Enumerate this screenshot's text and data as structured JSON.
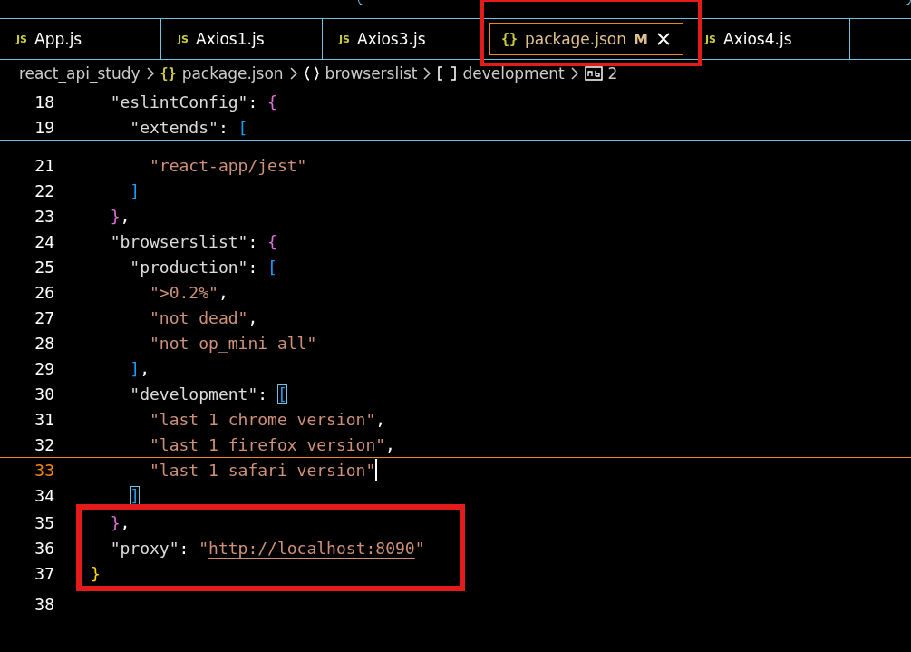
{
  "tabs": [
    {
      "kind": "js",
      "icon_text": "JS",
      "label": "App.js",
      "selected": false,
      "annotated": false
    },
    {
      "kind": "js",
      "icon_text": "JS",
      "label": "Axios1.js",
      "selected": false,
      "annotated": false
    },
    {
      "kind": "js",
      "icon_text": "JS",
      "label": "Axios3.js",
      "selected": false,
      "annotated": false
    },
    {
      "kind": "json",
      "icon_text": "{}",
      "label": "package.json",
      "selected": true,
      "status": "M",
      "annotated": true
    },
    {
      "kind": "js",
      "icon_text": "JS",
      "label": "Axios4.js",
      "selected": false,
      "annotated": false
    }
  ],
  "breadcrumbs": [
    {
      "kind": "folder",
      "label": "react_api_study"
    },
    {
      "kind": "json",
      "icon_text": "{}",
      "label": "package.json"
    },
    {
      "kind": "object",
      "label": "browserslist"
    },
    {
      "kind": "array",
      "label": "development"
    },
    {
      "kind": "string",
      "label": "2"
    }
  ],
  "sticky_lines": [
    {
      "number": "18",
      "tokens": [
        {
          "kind": "key",
          "text": "  \"eslintConfig\""
        },
        {
          "kind": "punct",
          "text": ": "
        },
        {
          "kind": "brace",
          "text": "{"
        }
      ]
    },
    {
      "number": "19",
      "tokens": [
        {
          "kind": "key",
          "text": "    \"extends\""
        },
        {
          "kind": "punct",
          "text": ": "
        },
        {
          "kind": "bracket",
          "text": "["
        }
      ]
    }
  ],
  "line_groups": [
    {
      "boxed": false,
      "lines": [
        {
          "number": "21",
          "current": false,
          "tokens": [
            {
              "kind": "string",
              "text": "      \"react-app/jest\""
            }
          ]
        },
        {
          "number": "22",
          "current": false,
          "tokens": [
            {
              "kind": "bracket",
              "text": "    ]"
            }
          ]
        },
        {
          "number": "23",
          "current": false,
          "tokens": [
            {
              "kind": "brace",
              "text": "  }"
            },
            {
              "kind": "punct",
              "text": ","
            }
          ]
        },
        {
          "number": "24",
          "current": false,
          "tokens": [
            {
              "kind": "key",
              "text": "  \"browserslist\""
            },
            {
              "kind": "punct",
              "text": ": "
            },
            {
              "kind": "brace",
              "text": "{"
            }
          ]
        },
        {
          "number": "25",
          "current": false,
          "tokens": [
            {
              "kind": "key",
              "text": "    \"production\""
            },
            {
              "kind": "punct",
              "text": ": "
            },
            {
              "kind": "bracket",
              "text": "["
            }
          ]
        },
        {
          "number": "26",
          "current": false,
          "tokens": [
            {
              "kind": "string",
              "text": "      \">0.2%\""
            },
            {
              "kind": "punct",
              "text": ","
            }
          ]
        },
        {
          "number": "27",
          "current": false,
          "tokens": [
            {
              "kind": "string",
              "text": "      \"not dead\""
            },
            {
              "kind": "punct",
              "text": ","
            }
          ]
        },
        {
          "number": "28",
          "current": false,
          "tokens": [
            {
              "kind": "string",
              "text": "      \"not op_mini all\""
            }
          ]
        },
        {
          "number": "29",
          "current": false,
          "tokens": [
            {
              "kind": "bracket",
              "text": "    ]"
            },
            {
              "kind": "punct",
              "text": ","
            }
          ]
        },
        {
          "number": "30",
          "current": false,
          "tokens": [
            {
              "kind": "key",
              "text": "    \"development\""
            },
            {
              "kind": "punct",
              "text": ": "
            },
            {
              "kind": "bracket_match",
              "text": "["
            }
          ]
        },
        {
          "number": "31",
          "current": false,
          "tokens": [
            {
              "kind": "string",
              "text": "      \"last 1 chrome version\""
            },
            {
              "kind": "punct",
              "text": ","
            }
          ]
        },
        {
          "number": "32",
          "current": false,
          "tokens": [
            {
              "kind": "string",
              "text": "      \"last 1 firefox version\""
            },
            {
              "kind": "punct",
              "text": ","
            }
          ]
        },
        {
          "number": "33",
          "current": true,
          "tokens": [
            {
              "kind": "string",
              "text": "      \"last 1 safari version\""
            }
          ]
        },
        {
          "number": "34",
          "current": false,
          "tokens": [
            {
              "kind": "bracket_match",
              "text": "    ]"
            }
          ]
        }
      ]
    },
    {
      "boxed": true,
      "lines": [
        {
          "number": "35",
          "current": false,
          "tokens": [
            {
              "kind": "brace",
              "text": "  }"
            },
            {
              "kind": "punct",
              "text": ","
            }
          ]
        },
        {
          "number": "36",
          "current": false,
          "tokens": [
            {
              "kind": "key",
              "text": "  \"proxy\""
            },
            {
              "kind": "punct",
              "text": ": "
            },
            {
              "kind": "string",
              "text": "\""
            },
            {
              "kind": "link",
              "text": "http://localhost:8090"
            },
            {
              "kind": "string",
              "text": "\""
            }
          ]
        },
        {
          "number": "37",
          "current": false,
          "tokens": [
            {
              "kind": "root_brace",
              "text": "}"
            }
          ]
        }
      ]
    },
    {
      "boxed": false,
      "lines": [
        {
          "number": "38",
          "current": false
        }
      ]
    }
  ]
}
